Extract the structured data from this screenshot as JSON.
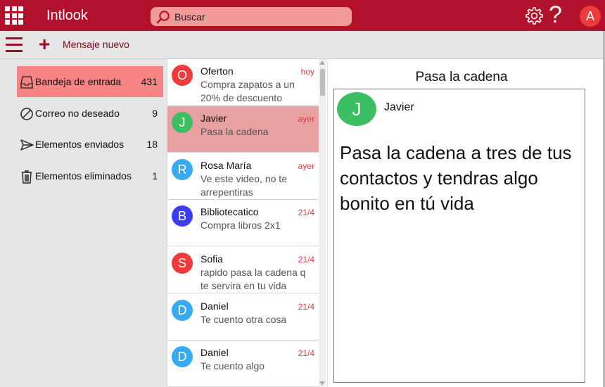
{
  "app": {
    "title": "Intlook"
  },
  "search": {
    "placeholder": "Buscar"
  },
  "user": {
    "initial": "A"
  },
  "toolbar": {
    "new_message_label": "Mensaje nuevo"
  },
  "folders": [
    {
      "label": "Bandeja de entrada",
      "count": "431",
      "icon": "inbox-icon",
      "active": true
    },
    {
      "label": "Correo no deseado",
      "count": "9",
      "icon": "spam-icon",
      "active": false
    },
    {
      "label": "Elementos enviados",
      "count": "18",
      "icon": "send-icon",
      "active": false
    },
    {
      "label": "Elementos eliminados",
      "count": "1",
      "icon": "trash-icon",
      "active": false
    }
  ],
  "messages": [
    {
      "initial": "O",
      "sender": "Oferton",
      "date": "hoy",
      "preview": "Compra zapatos a un 20% de descuento",
      "avatar_color": "#ef3b3b"
    },
    {
      "initial": "J",
      "sender": "Javier",
      "date": "ayer",
      "preview": "Pasa la cadena",
      "avatar_color": "#3cbf62"
    },
    {
      "initial": "R",
      "sender": "Rosa María",
      "date": "ayer",
      "preview": "Ve este video, no te arrepentiras",
      "avatar_color": "#36aaf2"
    },
    {
      "initial": "B",
      "sender": "Bibliotecatico",
      "date": "21/4",
      "preview": "Compra libros 2x1",
      "avatar_color": "#3d3df2"
    },
    {
      "initial": "S",
      "sender": "Sofia",
      "date": "21/4",
      "preview": "rapido pasa la cadena q te servira en tu vida",
      "avatar_color": "#ef3b3b"
    },
    {
      "initial": "D",
      "sender": "Daniel",
      "date": "21/4",
      "preview": "Te cuento otra cosa",
      "avatar_color": "#36aaf2"
    },
    {
      "initial": "D",
      "sender": "Daniel",
      "date": "21/4",
      "preview": "Te cuento algo",
      "avatar_color": "#36aaf2"
    }
  ],
  "reading": {
    "subject": "Pasa la cadena",
    "sender_initial": "J",
    "sender": "Javier",
    "body": "Pasa la cadena a tres de tus contactos y tendras algo bonito en tú vida"
  },
  "colors": {
    "brand": "#b2112b",
    "active_folder": "#f78484",
    "selected_message": "#e8a0a0",
    "date_red": "#e23a3a"
  }
}
